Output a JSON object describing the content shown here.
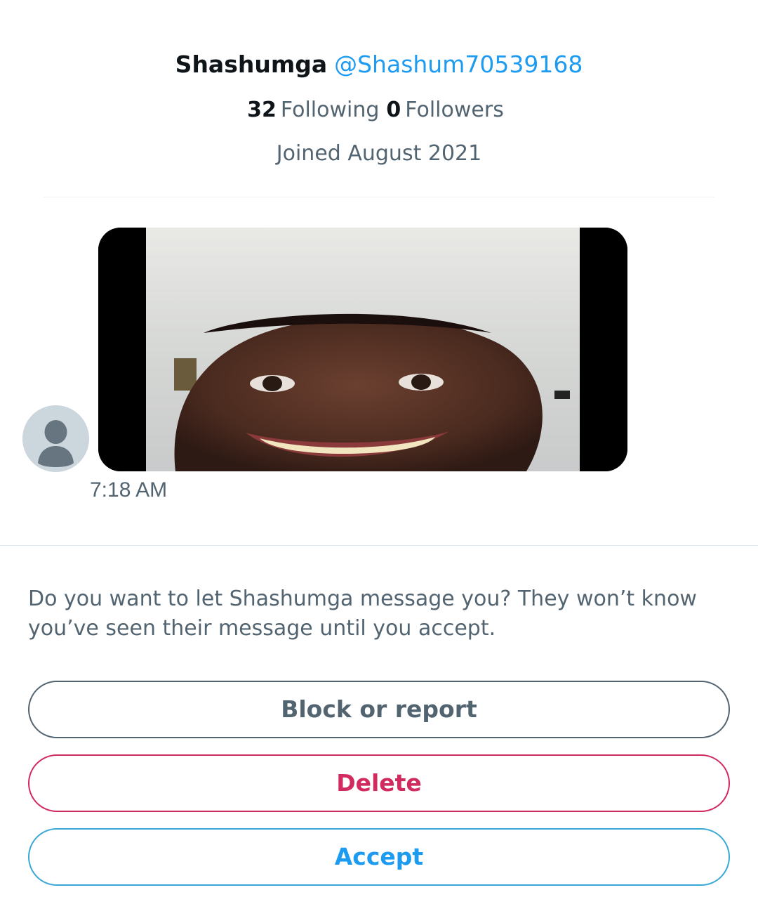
{
  "profile": {
    "display_name": "Shashumga",
    "handle": "@Shashum70539168",
    "following_count": "32",
    "following_label": "Following",
    "followers_count": "0",
    "followers_label": "Followers",
    "joined": "Joined August 2021"
  },
  "message": {
    "media_icon": "video-thumbnail",
    "timestamp": "7:18 AM"
  },
  "request": {
    "prompt": "Do you want to let Shashumga message you? They won’t know you’ve seen their message until you accept.",
    "buttons": {
      "block_report": "Block or report",
      "delete": "Delete",
      "accept": "Accept"
    }
  },
  "colors": {
    "link": "#1d9bf0",
    "secondary_text": "#536471",
    "danger": "#d02a5e"
  }
}
